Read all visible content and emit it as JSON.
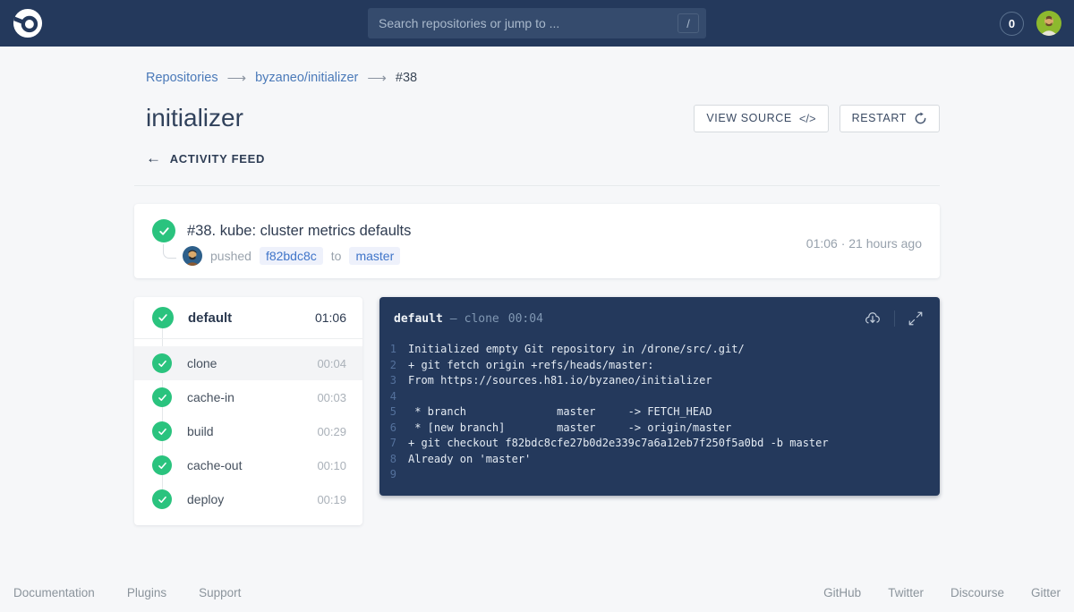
{
  "topbar": {
    "search_placeholder": "Search repositories or jump to ...",
    "search_shortcut": "/",
    "badge_count": "0"
  },
  "breadcrumb": {
    "repositories": "Repositories",
    "repo": "byzaneo/initializer",
    "build": "#38",
    "separator": "⟶"
  },
  "header": {
    "title": "initializer",
    "view_source_label": "VIEW SOURCE",
    "view_source_icon": "</>",
    "restart_label": "RESTART",
    "back_arrow": "←",
    "back_label": "ACTIVITY FEED"
  },
  "build_card": {
    "title": "#38. kube: cluster metrics defaults",
    "pushed_label": "pushed",
    "commit": "f82bdc8c",
    "to_label": "to",
    "branch": "master",
    "time": "01:06 · 21 hours ago"
  },
  "steps": {
    "header": {
      "name": "default",
      "time": "01:06"
    },
    "items": [
      {
        "name": "clone",
        "time": "00:04"
      },
      {
        "name": "cache-in",
        "time": "00:03"
      },
      {
        "name": "build",
        "time": "00:29"
      },
      {
        "name": "cache-out",
        "time": "00:10"
      },
      {
        "name": "deploy",
        "time": "00:19"
      }
    ]
  },
  "console": {
    "title": "default",
    "separator": "—",
    "step": "clone",
    "time": "00:04",
    "lines": [
      {
        "n": "1",
        "text": "Initialized empty Git repository in /drone/src/.git/"
      },
      {
        "n": "2",
        "text": "+ git fetch origin +refs/heads/master:"
      },
      {
        "n": "3",
        "text": "From https://sources.h81.io/byzaneo/initializer"
      },
      {
        "n": "4",
        "text": ""
      },
      {
        "n": "5",
        "text": " * branch              master     -> FETCH_HEAD"
      },
      {
        "n": "6",
        "text": " * [new branch]        master     -> origin/master"
      },
      {
        "n": "7",
        "text": "+ git checkout f82bdc8cfe27b0d2e339c7a6a12eb7f250f5a0bd -b master"
      },
      {
        "n": "8",
        "text": "Already on 'master'"
      },
      {
        "n": "9",
        "text": ""
      }
    ]
  },
  "footer": {
    "left": [
      "Documentation",
      "Plugins",
      "Support"
    ],
    "right": [
      "GitHub",
      "Twitter",
      "Discourse",
      "Gitter"
    ]
  },
  "colors": {
    "navbar": "#24395c",
    "console_bg": "#24395c",
    "success_green": "#2ac37e",
    "link_blue": "#4b7ab9",
    "chip_blue": "#4075c9",
    "chip_bg": "#eef1fb",
    "page_bg": "#f6f7f9"
  }
}
